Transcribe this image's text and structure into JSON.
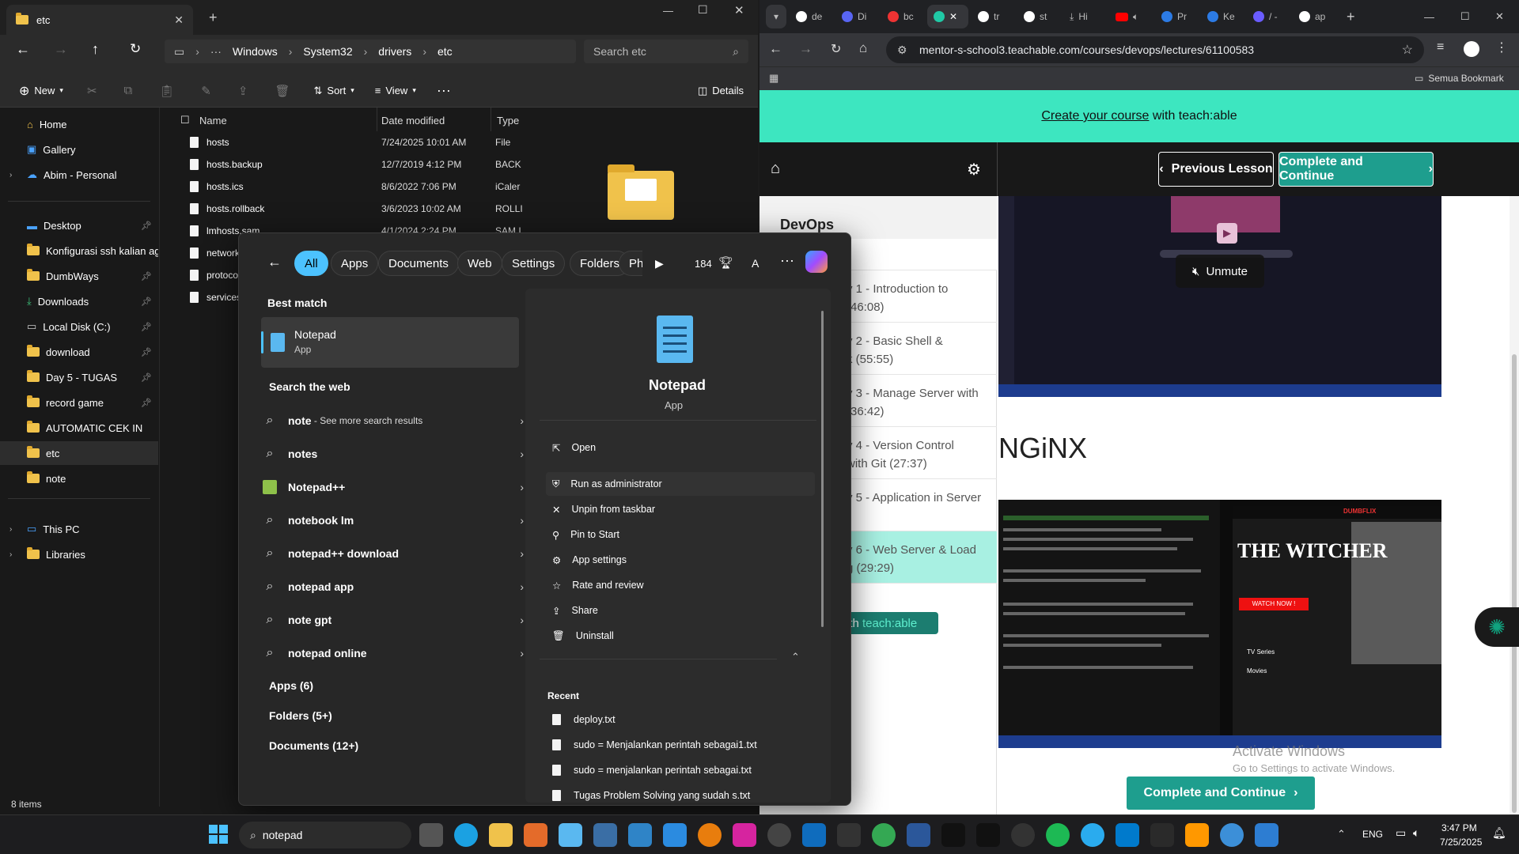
{
  "explorer": {
    "tab_title": "etc",
    "breadcrumb": [
      "Windows",
      "System32",
      "drivers",
      "etc"
    ],
    "search_placeholder": "Search etc",
    "toolbar": {
      "new": "New",
      "sort": "Sort",
      "view": "View",
      "details": "Details"
    },
    "nav": [
      {
        "label": "Home",
        "icon": "home-icon"
      },
      {
        "label": "Gallery",
        "icon": "gallery-icon"
      },
      {
        "label": "Abim - Personal",
        "icon": "cloud-icon"
      },
      {
        "label": "Desktop",
        "icon": "folder-icon"
      },
      {
        "label": "Konfigurasi ssh kalian ag",
        "icon": "folder-icon"
      },
      {
        "label": "DumbWays",
        "icon": "folder-icon"
      },
      {
        "label": "Downloads",
        "icon": "download-icon"
      },
      {
        "label": "Local Disk (C:)",
        "icon": "drive-icon"
      },
      {
        "label": "download",
        "icon": "folder-icon"
      },
      {
        "label": "Day 5 - TUGAS",
        "icon": "folder-icon"
      },
      {
        "label": "record game",
        "icon": "folder-icon"
      },
      {
        "label": "AUTOMATIC CEK IN",
        "icon": "folder-icon"
      },
      {
        "label": "etc",
        "icon": "folder-icon"
      },
      {
        "label": "note",
        "icon": "folder-icon"
      },
      {
        "label": "This PC",
        "icon": "pc-icon"
      },
      {
        "label": "Libraries",
        "icon": "folder-icon"
      }
    ],
    "columns": {
      "name": "Name",
      "date": "Date modified",
      "type": "Type"
    },
    "files": [
      {
        "name": "hosts",
        "date": "7/24/2025 10:01 AM",
        "type": "File"
      },
      {
        "name": "hosts.backup",
        "date": "12/7/2019 4:12 PM",
        "type": "BACK"
      },
      {
        "name": "hosts.ics",
        "date": "8/6/2022 7:06 PM",
        "type": "iCaler"
      },
      {
        "name": "hosts.rollback",
        "date": "3/6/2023 10:02 AM",
        "type": "ROLLI"
      },
      {
        "name": "lmhosts.sam",
        "date": "4/1/2024 2:24 PM",
        "type": "SAM I"
      },
      {
        "name": "network",
        "date": "",
        "type": ""
      },
      {
        "name": "protocol",
        "date": "",
        "type": ""
      },
      {
        "name": "services",
        "date": "",
        "type": ""
      }
    ],
    "status": "8 items"
  },
  "search": {
    "chips": [
      "All",
      "Apps",
      "Documents",
      "Web",
      "Settings",
      "Folders",
      "Ph"
    ],
    "points": "184",
    "avatar_letter": "A",
    "best_match_label": "Best match",
    "best_match": {
      "name": "Notepad",
      "kind": "App"
    },
    "web_label": "Search the web",
    "web_results": [
      {
        "bold": "note",
        "rest": " - See more search results"
      },
      {
        "bold": "notes",
        "rest": ""
      },
      {
        "bold": "Notepad++",
        "rest": ""
      },
      {
        "bold": "notebook lm",
        "rest": ""
      },
      {
        "bold": "notepad++ download",
        "rest": ""
      },
      {
        "bold": "notepad app",
        "rest": ""
      },
      {
        "bold": "note gpt",
        "rest": ""
      },
      {
        "bold": "notepad online",
        "rest": ""
      }
    ],
    "groups": [
      "Apps (6)",
      "Folders (5+)",
      "Documents (12+)"
    ],
    "detail": {
      "name": "Notepad",
      "kind": "App"
    },
    "actions": [
      "Open",
      "Run as administrator",
      "Unpin from taskbar",
      "Pin to Start",
      "App settings",
      "Rate and review",
      "Share",
      "Uninstall"
    ],
    "recent_label": "Recent",
    "recent": [
      "deploy.txt",
      "sudo = Menjalankan perintah sebagai1.txt",
      "sudo = menjalankan perintah sebagai.txt",
      "Tugas Problem Solving yang sudah s.txt"
    ]
  },
  "chrome": {
    "tabs": [
      "de",
      "Di",
      "bc",
      "",
      "tr",
      "st",
      "Hi",
      "",
      "Pr",
      "Ke",
      "/ -",
      "ap"
    ],
    "url": "mentor-s-school3.teachable.com/courses/devops/lectures/61100583",
    "bookmarks_label": "Semua Bookmark",
    "banner_link": "Create your course",
    "banner_text": " with teach:able",
    "prev_lesson": "Previous Lesson",
    "complete": "Complete and Continue",
    "course_title": "DevOps",
    "lessons": [
      {
        "l1": "y 1 - Introduction to",
        "l2": "(46:08)"
      },
      {
        "l1": "y 2 - Basic Shell &",
        "l2": "k (55:55)"
      },
      {
        "l1": "y 3 - Manage Server with",
        "l2": "(36:42)"
      },
      {
        "l1": "y 4 - Version Control",
        "l2": "with Git (27:37)"
      },
      {
        "l1": "y 5 - Application in Server",
        "l2": ""
      },
      {
        "l1": "y 6 - Web Server & Load",
        "l2": "g (29:29)"
      }
    ],
    "teachable_badge_1": "ith ",
    "teachable_badge_2": "teach:able",
    "unmute": "Unmute",
    "section_heading": "NGiNX",
    "witcher_title": "THE WITCHER",
    "witcher_brand": "DUMBFLIX",
    "watch_now": "WATCH NOW !",
    "tv_series": "TV Series",
    "movies": "Movies",
    "activate_1": "Activate Windows",
    "activate_2": "Go to Settings to activate Windows."
  },
  "taskbar": {
    "search_text": "notepad",
    "lang": "ENG",
    "time": "3:47 PM",
    "date": "7/25/2025"
  },
  "colors": {
    "accent": "#4cc2ff",
    "teal": "#3de6c0",
    "button_teal": "#1e9e8e",
    "folder": "#f0c24b"
  }
}
